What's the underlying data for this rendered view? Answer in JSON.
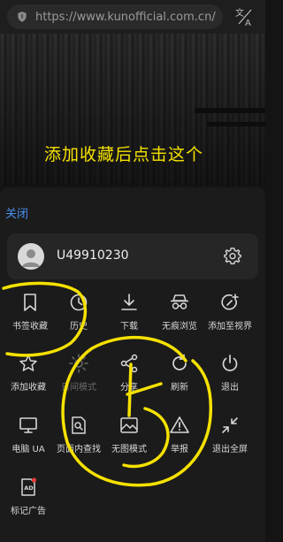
{
  "addressbar": {
    "url": "https://www.kunofficial.com.cn/"
  },
  "page": {
    "caption": "添加收藏后点击这个"
  },
  "sheet": {
    "close_label": "关闭",
    "username": "U49910230",
    "menu": [
      {
        "label": "书签收藏",
        "icon": "bookmark-icon",
        "enabled": true
      },
      {
        "label": "历史",
        "icon": "history-icon",
        "enabled": true
      },
      {
        "label": "下载",
        "icon": "download-icon",
        "enabled": true
      },
      {
        "label": "无痕浏览",
        "icon": "incognito-icon",
        "enabled": true
      },
      {
        "label": "添加至视界",
        "icon": "add-view-icon",
        "enabled": true
      },
      {
        "label": "添加收藏",
        "icon": "star-icon",
        "enabled": true
      },
      {
        "label": "日间模式",
        "icon": "sun-icon",
        "enabled": false
      },
      {
        "label": "分享",
        "icon": "share-icon",
        "enabled": true
      },
      {
        "label": "刷新",
        "icon": "refresh-icon",
        "enabled": true
      },
      {
        "label": "退出",
        "icon": "power-icon",
        "enabled": true
      },
      {
        "label": "电脑 UA",
        "icon": "monitor-icon",
        "enabled": true
      },
      {
        "label": "页面内查找",
        "icon": "find-in-page-icon",
        "enabled": true
      },
      {
        "label": "无图模式",
        "icon": "no-image-icon",
        "enabled": true
      },
      {
        "label": "举报",
        "icon": "warning-icon",
        "enabled": true
      },
      {
        "label": "退出全屏",
        "icon": "exit-fullscreen-icon",
        "enabled": true
      },
      {
        "label": "标记广告",
        "icon": "ad-mark-icon",
        "enabled": true
      }
    ]
  },
  "colors": {
    "accent_link": "#4a8ff0",
    "annotation": "#f5e100",
    "sheet_bg": "#1b1b1b"
  }
}
